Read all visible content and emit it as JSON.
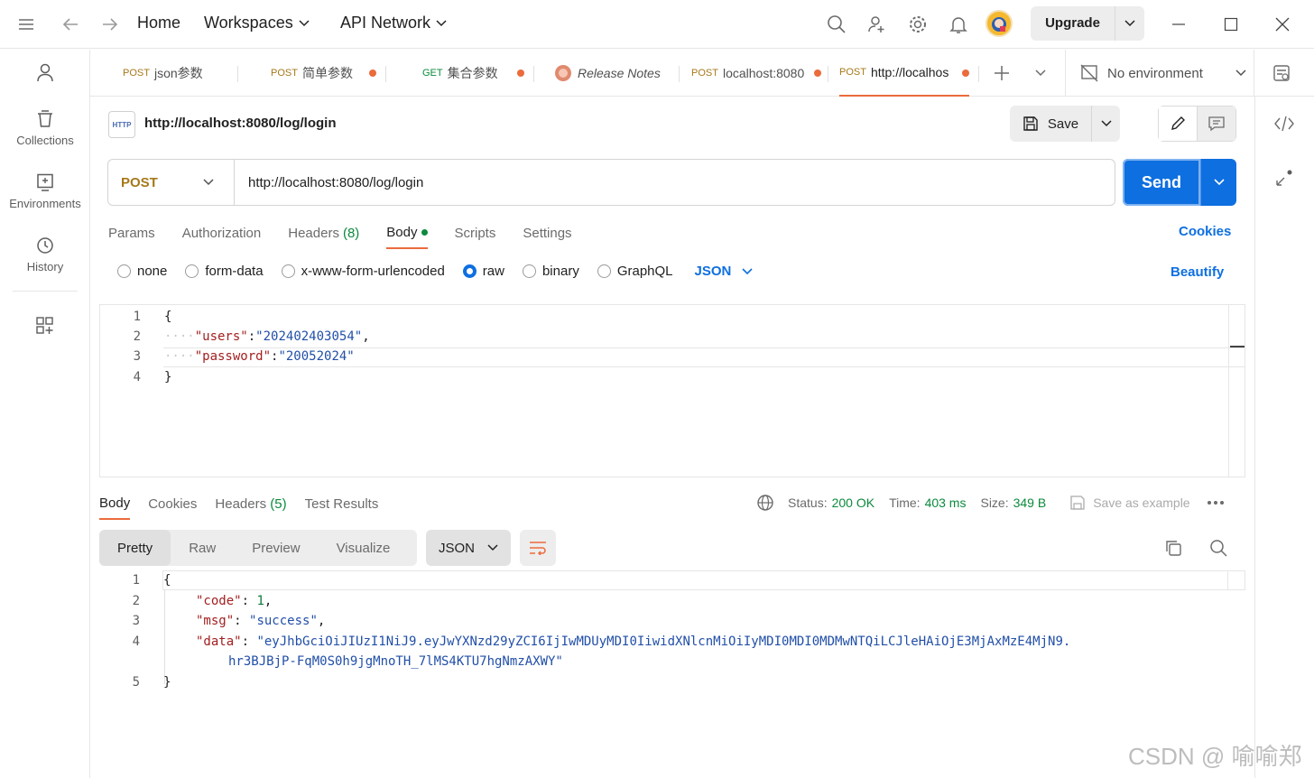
{
  "topbar": {
    "home": "Home",
    "workspaces": "Workspaces",
    "api_network": "API Network",
    "upgrade": "Upgrade"
  },
  "sidebar": {
    "items": [
      {
        "label": "Collections"
      },
      {
        "label": "Environments"
      },
      {
        "label": "History"
      }
    ]
  },
  "tabs": [
    {
      "method": "POST",
      "title": "json参数",
      "method_color": "#a6781a",
      "modified": false
    },
    {
      "method": "POST",
      "title": "简单参数",
      "method_color": "#a6781a",
      "modified": true
    },
    {
      "method": "GET",
      "title": "集合参数",
      "method_color": "#0b8a3d",
      "modified": true
    },
    {
      "method": "",
      "title": "Release Notes",
      "method_color": "",
      "modified": false
    },
    {
      "method": "POST",
      "title": "localhost:8080",
      "method_color": "#a6781a",
      "modified": true
    },
    {
      "method": "POST",
      "title": "http://localhos",
      "method_color": "#a6781a",
      "modified": true
    }
  ],
  "environment": {
    "label": "No environment"
  },
  "request": {
    "title": "http://localhost:8080/log/login",
    "http_badge": "HTTP",
    "save_label": "Save",
    "method": "POST",
    "url": "http://localhost:8080/log/login",
    "send_label": "Send"
  },
  "request_tabs": {
    "params": "Params",
    "authorization": "Authorization",
    "headers": "Headers",
    "headers_count": "(8)",
    "body": "Body",
    "scripts": "Scripts",
    "settings": "Settings",
    "cookies": "Cookies"
  },
  "body_modes": {
    "none": "none",
    "form_data": "form-data",
    "urlencoded": "x-www-form-urlencoded",
    "raw": "raw",
    "binary": "binary",
    "graphql": "GraphQL",
    "selected": "raw",
    "language": "JSON",
    "beautify": "Beautify"
  },
  "request_body": {
    "line_numbers": [
      "1",
      "2",
      "3",
      "4"
    ],
    "open": "{",
    "close": "}",
    "k1": "\"users\"",
    "v1": "\"202402403054\"",
    "k2": "\"password\"",
    "v2": "\"20052024\""
  },
  "response_tabs": {
    "body": "Body",
    "cookies": "Cookies",
    "headers": "Headers",
    "headers_count": "(5)",
    "test_results": "Test Results"
  },
  "response_status": {
    "status_label": "Status:",
    "status_value": "200 OK",
    "time_label": "Time:",
    "time_value": "403 ms",
    "size_label": "Size:",
    "size_value": "349 B",
    "save_example": "Save as example"
  },
  "response_view": {
    "pretty": "Pretty",
    "raw": "Raw",
    "preview": "Preview",
    "visualize": "Visualize",
    "format": "JSON"
  },
  "response_body": {
    "line_numbers": [
      "1",
      "2",
      "3",
      "4",
      "5"
    ],
    "open": "{",
    "close": "}",
    "code_key": "\"code\"",
    "code_val": "1",
    "msg_key": "\"msg\"",
    "msg_val": "\"success\"",
    "data_key": "\"data\"",
    "data_val_1": "\"eyJhbGciOiJIUzI1NiJ9.eyJwYXNzd29yZCI6IjIwMDUyMDI0IiwidXNlcnMiOiIyMDI0MDI0MDMwNTQiLCJleHAiOjE3MjAxMzE4MjN9.",
    "data_val_2": "hr3BJBjP-FqM0S0h9jgMnoTH_7lMS4KTU7hgNmzAXWY\""
  },
  "watermark": "CSDN @ 喻喻郑",
  "colors": {
    "accent": "#0e6fe0",
    "tab_indicator": "#eb6b3b",
    "status_ok": "#0b8a3d"
  }
}
